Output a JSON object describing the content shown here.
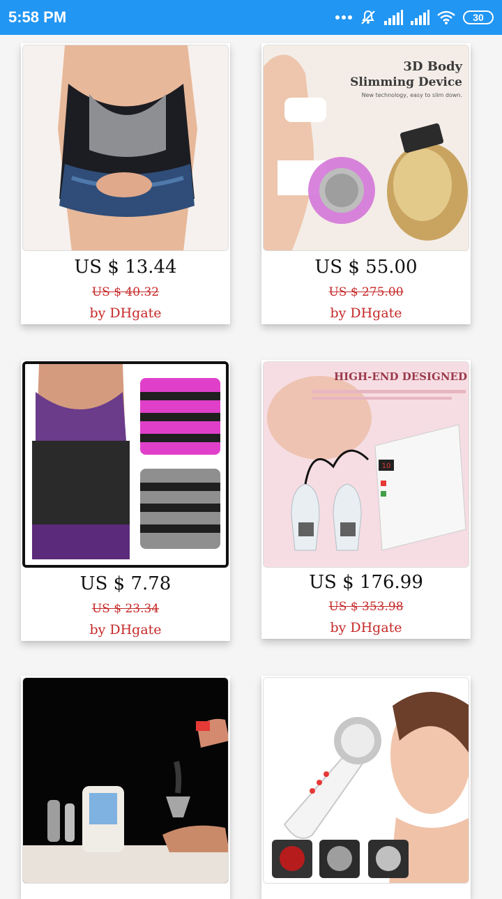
{
  "status_bar": {
    "time": "5:58 PM",
    "battery": "30",
    "icons": [
      "more-dots-icon",
      "mute-icon",
      "signal-icon",
      "signal-icon",
      "wifi-icon",
      "battery-icon"
    ]
  },
  "products": [
    {
      "image": "sauna-sweat-vest-photo",
      "price": "US $ 13.44",
      "original_price": "US $ 40.32",
      "seller": "by DHgate"
    },
    {
      "image": "slimming-device-photo",
      "image_heading": "3D Body",
      "image_heading_2": "Slimming Device",
      "image_caption": "New technology, easy to slim down.",
      "price": "US $ 55.00",
      "original_price": "US $ 275.00",
      "seller": "by DHgate"
    },
    {
      "image": "waist-trainer-belts-photo",
      "price": "US $ 7.78",
      "original_price": "US $ 23.34",
      "seller": "by DHgate"
    },
    {
      "image": "vacuum-therapy-machine-photo",
      "image_heading": "HIGH-END DESIGNED",
      "image_display": "10",
      "price": "US $ 176.99",
      "original_price": "US $ 353.98",
      "seller": "by DHgate"
    },
    {
      "image": "cavitation-machine-photo"
    },
    {
      "image": "ultrasonic-massager-photo"
    }
  ],
  "colors": {
    "status_bar": "#2196f3",
    "seller_text": "#c62828",
    "background": "#f5f5f5"
  }
}
